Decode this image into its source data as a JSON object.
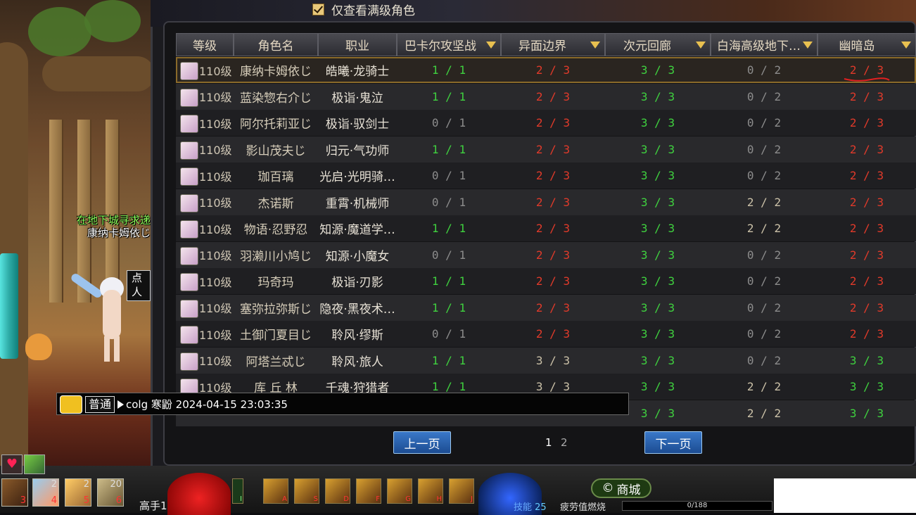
{
  "filter": {
    "label": "仅查看满级角色",
    "checked": true
  },
  "columns": [
    "等级",
    "角色名",
    "职业",
    "巴卡尔攻坚战",
    "异面边界",
    "次元回廊",
    "白海高级地下…",
    "幽暗岛"
  ],
  "colors": {
    "clear_done": "#3fd13f",
    "pending": "#e03a2a",
    "none": "#8c8c8c",
    "neutral": "#cbc1a8",
    "selection": "#8a6a2a"
  },
  "rows": [
    {
      "level": "110级",
      "name": "康纳卡姆依じ",
      "job": "皓曦·龙骑士",
      "c1": "1 / 1",
      "c2": "2 / 3",
      "c3": "3 / 3",
      "c4": "0 / 2",
      "c5": "2 / 3"
    },
    {
      "level": "110级",
      "name": "蓝染惣右介じ",
      "job": "极诣·鬼泣",
      "c1": "1 / 1",
      "c2": "2 / 3",
      "c3": "3 / 3",
      "c4": "0 / 2",
      "c5": "2 / 3"
    },
    {
      "level": "110级",
      "name": "阿尔托莉亚じ",
      "job": "极诣·驭剑士",
      "c1": "0 / 1",
      "c2": "2 / 3",
      "c3": "3 / 3",
      "c4": "0 / 2",
      "c5": "2 / 3"
    },
    {
      "level": "110级",
      "name": "影山茂夫じ",
      "job": "归元·气功师",
      "c1": "1 / 1",
      "c2": "2 / 3",
      "c3": "3 / 3",
      "c4": "0 / 2",
      "c5": "2 / 3"
    },
    {
      "level": "110级",
      "name": "珈百璃",
      "job": "光启·光明骑…",
      "c1": "0 / 1",
      "c2": "2 / 3",
      "c3": "3 / 3",
      "c4": "0 / 2",
      "c5": "2 / 3"
    },
    {
      "level": "110级",
      "name": "杰诺斯",
      "job": "重霄·机械师",
      "c1": "0 / 1",
      "c2": "2 / 3",
      "c3": "3 / 3",
      "c4": "2 / 2",
      "c5": "2 / 3"
    },
    {
      "level": "110级",
      "name": "物语·忍野忍",
      "job": "知源·魔道学…",
      "c1": "1 / 1",
      "c2": "2 / 3",
      "c3": "3 / 3",
      "c4": "2 / 2",
      "c5": "2 / 3"
    },
    {
      "level": "110级",
      "name": "羽濑川小鸠じ",
      "job": "知源·小魔女",
      "c1": "0 / 1",
      "c2": "2 / 3",
      "c3": "3 / 3",
      "c4": "0 / 2",
      "c5": "2 / 3"
    },
    {
      "level": "110级",
      "name": "玛奇玛",
      "job": "极诣·刃影",
      "c1": "1 / 1",
      "c2": "2 / 3",
      "c3": "3 / 3",
      "c4": "0 / 2",
      "c5": "2 / 3"
    },
    {
      "level": "110级",
      "name": "塞弥拉弥斯じ",
      "job": "隐夜·黑夜术…",
      "c1": "1 / 1",
      "c2": "2 / 3",
      "c3": "3 / 3",
      "c4": "0 / 2",
      "c5": "2 / 3"
    },
    {
      "level": "110级",
      "name": "土御门夏目じ",
      "job": "聆风·缪斯",
      "c1": "0 / 1",
      "c2": "2 / 3",
      "c3": "3 / 3",
      "c4": "0 / 2",
      "c5": "2 / 3"
    },
    {
      "level": "110级",
      "name": "阿塔兰忒じ",
      "job": "聆风·旅人",
      "c1": "1 / 1",
      "c2": "3 / 3",
      "c3": "3 / 3",
      "c4": "0 / 2",
      "c5": "3 / 3"
    },
    {
      "level": "110级",
      "name": "库 丘 林",
      "job": "千魂·狩猎者",
      "c1": "1 / 1",
      "c2": "3 / 3",
      "c3": "3 / 3",
      "c4": "2 / 2",
      "c5": "3 / 3"
    },
    {
      "level": "",
      "name": "",
      "job": "",
      "c1": "",
      "c2": "",
      "c3": "3 / 3",
      "c4": "2 / 2",
      "c5": "3 / 3"
    }
  ],
  "pager": {
    "prev": "上一页",
    "next": "下一页",
    "pages": [
      "1",
      "2"
    ],
    "current": "1"
  },
  "chat": {
    "channel": "普通",
    "message": "colg 寒鼢 2024-04-15 23:03:35"
  },
  "scene": {
    "npc_line1": "在地下城寻求递",
    "npc_line2": "康纳卡姆依じ",
    "bubble": "点\n人"
  },
  "hud": {
    "shop": "商城",
    "player": "高手14",
    "skill_label": "技能",
    "skill_points": "25",
    "fatigue": "疲劳值燃烧",
    "xp": "0/188",
    "slot_counts": [
      "2",
      "2",
      "20"
    ],
    "slot_keys": [
      "3",
      "4",
      "5",
      "6"
    ],
    "hotkeys": [
      "I",
      "A",
      "S",
      "D",
      "F",
      "G",
      "H",
      "J"
    ]
  }
}
